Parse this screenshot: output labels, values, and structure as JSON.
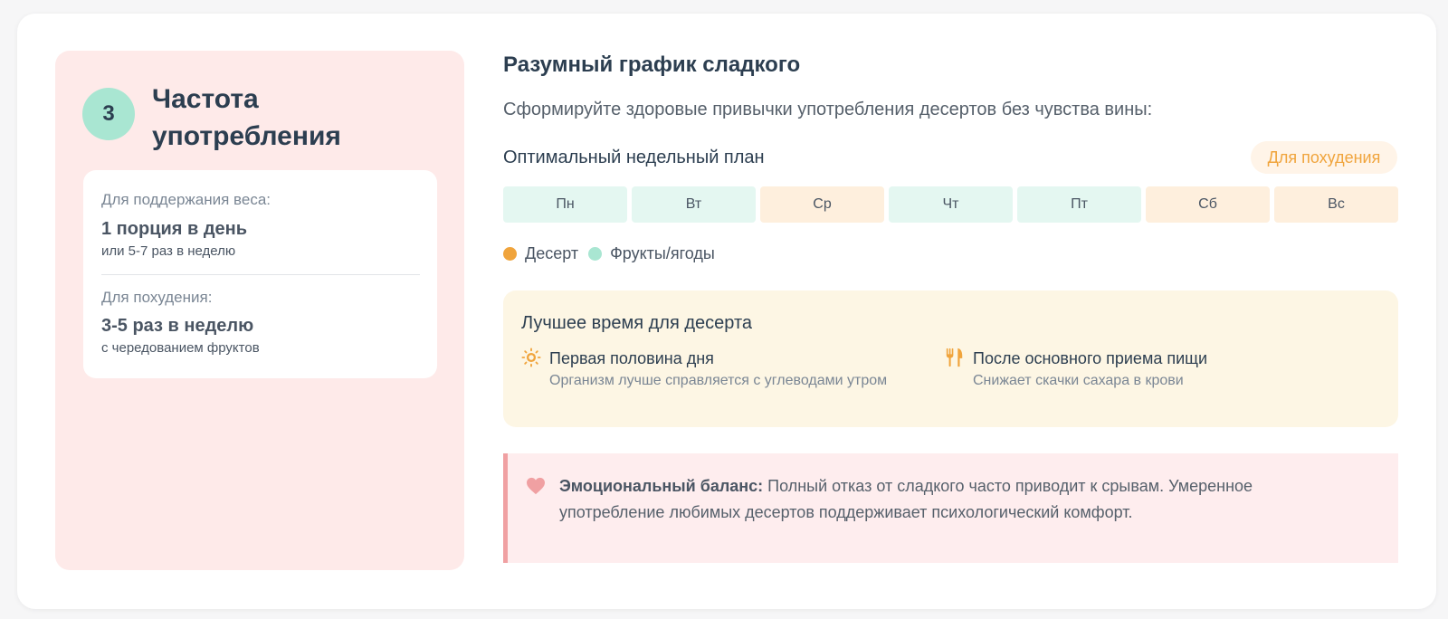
{
  "left": {
    "step": "3",
    "title": "Частота употребления",
    "maintain": {
      "label": "Для поддержания веса:",
      "value": "1 порция в день",
      "sub": "или 5-7 раз в неделю"
    },
    "lose": {
      "label": "Для похудения:",
      "value": "3-5 раз в неделю",
      "sub": "с чередованием фруктов"
    }
  },
  "main": {
    "title": "Разумный график сладкого",
    "description": "Сформируйте здоровые привычки употребления десертов без чувства вины:"
  },
  "plan": {
    "title": "Оптимальный недельный план",
    "tag": "Для похудения",
    "days": [
      {
        "label": "Пн",
        "type": "fruit"
      },
      {
        "label": "Вт",
        "type": "fruit"
      },
      {
        "label": "Ср",
        "type": "dessert"
      },
      {
        "label": "Чт",
        "type": "fruit"
      },
      {
        "label": "Пт",
        "type": "fruit"
      },
      {
        "label": "Сб",
        "type": "dessert"
      },
      {
        "label": "Вс",
        "type": "dessert"
      }
    ],
    "legend": [
      {
        "label": "Десерт",
        "color": "#f0a43c"
      },
      {
        "label": "Фрукты/ягоды",
        "color": "#a9e6d2"
      }
    ]
  },
  "best_time": {
    "title": "Лучшее время для десерта",
    "tips": [
      {
        "icon": "sun-icon",
        "head": "Первая половина дня",
        "text": "Организм лучше справляется с углеводами утром"
      },
      {
        "icon": "utensils-icon",
        "head": "После основного приема пищи",
        "text": "Снижает скачки сахара в крови"
      }
    ]
  },
  "emotional": {
    "icon": "heart-icon",
    "bold": "Эмоциональный баланс:",
    "text": " Полный отказ от сладкого часто приводит к срывам. Умеренное употребление любимых десертов поддерживает психологический комфорт."
  },
  "colors": {
    "accent_orange": "#f0a43c",
    "accent_mint": "#a9e6d2",
    "left_panel_bg": "#feeae9",
    "emotional_border": "#f0a0a2"
  }
}
